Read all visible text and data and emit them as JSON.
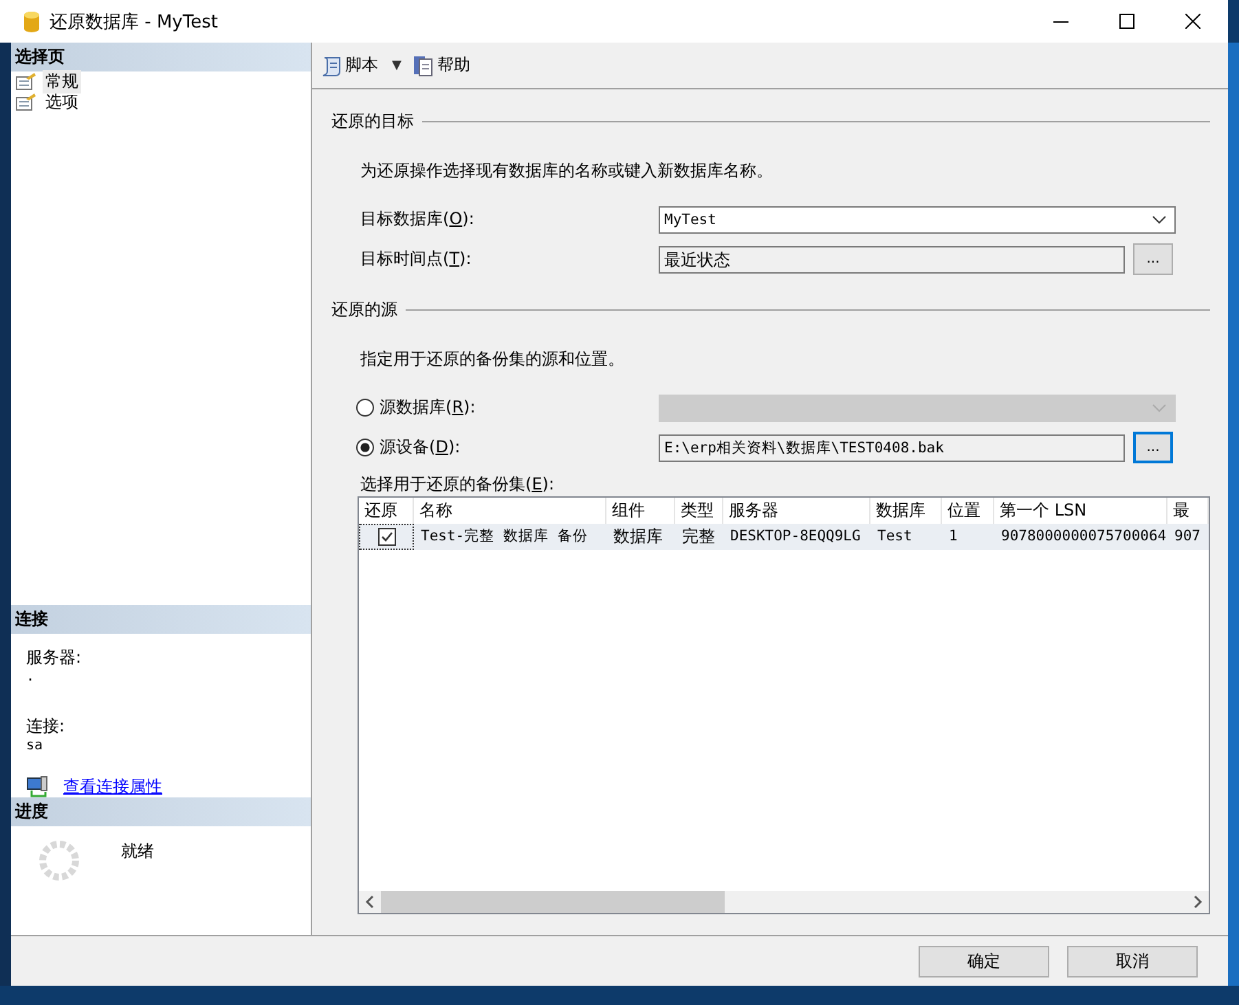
{
  "window": {
    "title": "还原数据库 - MyTest"
  },
  "sidebar": {
    "header": "选择页",
    "items": [
      {
        "label": "常规",
        "selected": true
      },
      {
        "label": "选项",
        "selected": false
      }
    ]
  },
  "connection": {
    "header": "连接",
    "server_label": "服务器:",
    "server_value": ".",
    "login_label": "连接:",
    "login_value": "sa",
    "link": "查看连接属性"
  },
  "progress": {
    "header": "进度",
    "status": "就绪"
  },
  "toolbar": {
    "script": "脚本",
    "dropdown": "▼",
    "help": "帮助"
  },
  "target": {
    "heading": "还原的目标",
    "description": "为还原操作选择现有数据库的名称或键入新数据库名称。",
    "database_label": "目标数据库(**O**):",
    "database_value": "MyTest",
    "time_label": "目标时间点(**T**):",
    "time_value": "最近状态",
    "browse": "..."
  },
  "source": {
    "heading": "还原的源",
    "description": "指定用于还原的备份集的源和位置。",
    "options": [
      {
        "label": "源数据库(**R**):",
        "selected": false,
        "kind": "dropdown",
        "disabled": true
      },
      {
        "label": "源设备(**D**):",
        "selected": true,
        "kind": "file",
        "value": "E:\\erp相关资料\\数据库\\TEST0408.bak",
        "disabled": false,
        "browse": "..."
      }
    ]
  },
  "backup_sets": {
    "label": "选择用于还原的备份集(**E**):",
    "columns": [
      "还原",
      "名称",
      "组件",
      "类型",
      "服务器",
      "数据库",
      "位置",
      "第一个 LSN",
      "最"
    ],
    "rows": [
      {
        "cells": [
          {
            "checked": true
          },
          "Test-完整 数据库 备份",
          "数据库",
          "完整",
          "DESKTOP-8EQQ9LG",
          "Test",
          "1",
          "9078000000075700064",
          "907"
        ]
      }
    ]
  },
  "buttons": [
    "确定",
    "取消"
  ]
}
